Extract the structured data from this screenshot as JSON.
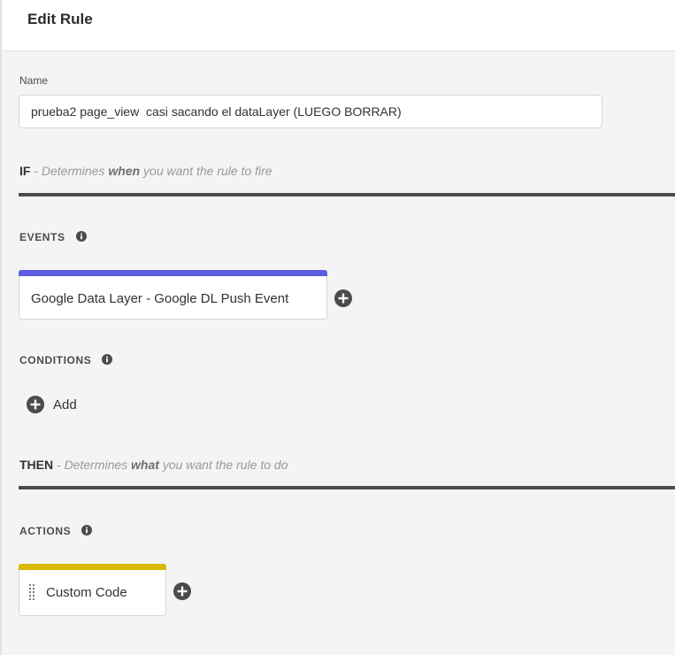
{
  "header": {
    "title": "Edit Rule"
  },
  "name": {
    "label": "Name",
    "value": "prueba2 page_view  casi sacando el dataLayer (LUEGO BORRAR)"
  },
  "if_section": {
    "keyword": "IF",
    "prefix": " - Determines ",
    "emphasis": "when",
    "suffix": " you want the rule to fire"
  },
  "events": {
    "label": "EVENTS",
    "items": [
      {
        "label": "Google Data Layer - Google DL Push Event",
        "accent": "#5c5ce0"
      }
    ]
  },
  "conditions": {
    "label": "CONDITIONS",
    "add_label": "Add"
  },
  "then_section": {
    "keyword": "THEN",
    "prefix": " - Determines ",
    "emphasis": "what",
    "suffix": " you want the rule to do"
  },
  "actions": {
    "label": "ACTIONS",
    "items": [
      {
        "label": "Custom Code",
        "accent": "#d9b800"
      }
    ]
  },
  "icons": {
    "info": "info-icon",
    "add": "add-circle-icon",
    "drag": "drag-handle-icon"
  }
}
